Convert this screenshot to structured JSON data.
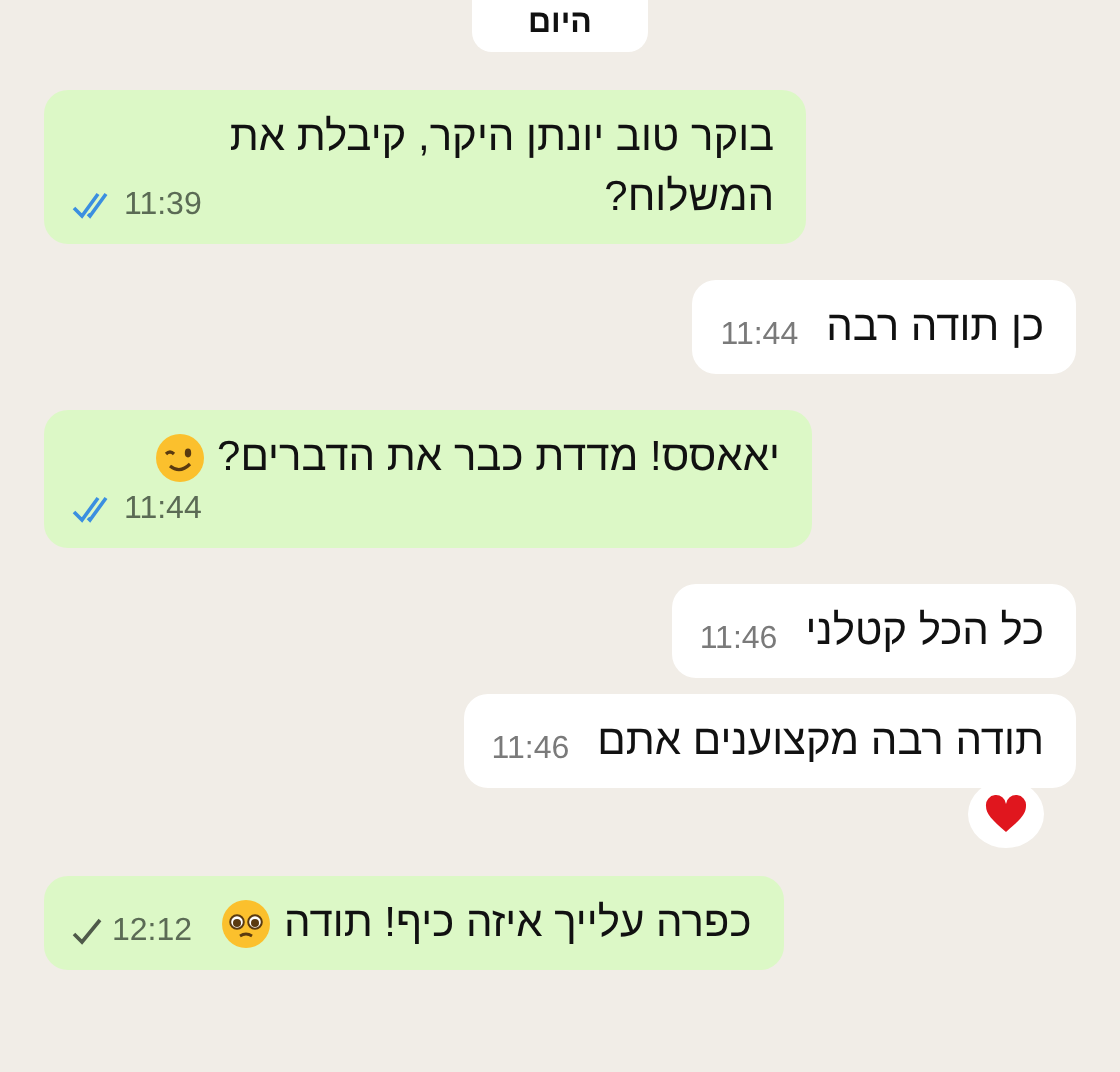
{
  "date_divider": "היום",
  "messages": [
    {
      "kind": "outgoing",
      "lines": [
        "בוקר טוב יונתן היקר, קיבלת את",
        "המשלוח?"
      ],
      "time": "11:39",
      "read": true
    },
    {
      "kind": "incoming",
      "lines": [
        "כן תודה רבה"
      ],
      "time": "11:44"
    },
    {
      "kind": "outgoing",
      "lines": [
        "יאאסס! מדדת כבר את הדברים?"
      ],
      "emoji": {
        "kind": "wink"
      },
      "time": "11:44",
      "read": true
    },
    {
      "kind": "incoming",
      "lines": [
        "כל הכל קטלני"
      ],
      "time": "11:46"
    },
    {
      "kind": "incoming",
      "lines": [
        "תודה רבה מקצוענים אתם"
      ],
      "time": "11:46",
      "reaction": {
        "kind": "heart"
      }
    },
    {
      "kind": "outgoing",
      "lines": [
        "כפרה עלייך איזה כיף! תודה"
      ],
      "emoji": {
        "kind": "pleading"
      },
      "time": "12:12",
      "read": false
    }
  ]
}
